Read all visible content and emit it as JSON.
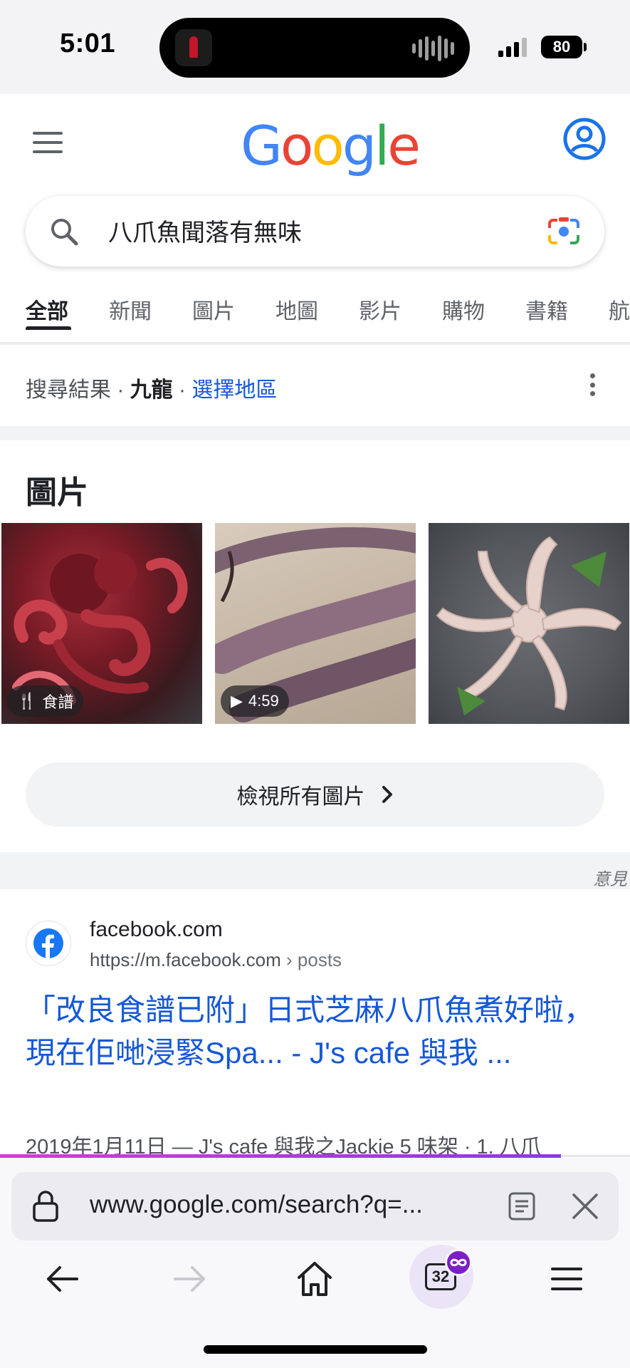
{
  "status_bar": {
    "time": "5:01",
    "battery": "80"
  },
  "header": {
    "logo": "Google"
  },
  "search": {
    "query": "八爪魚聞落有無味"
  },
  "tabs": [
    "全部",
    "新聞",
    "圖片",
    "地圖",
    "影片",
    "購物",
    "書籍",
    "航"
  ],
  "location": {
    "prefix": "搜尋結果",
    "sep1": "·",
    "place": "九龍",
    "sep2": "·",
    "choose": "選擇地區"
  },
  "images": {
    "title": "圖片",
    "thumbs": [
      {
        "badge": "食譜",
        "badge_icon": "utensils-icon"
      },
      {
        "badge": "4:59",
        "badge_icon": "play-icon"
      },
      {
        "badge": null
      }
    ],
    "view_all": "檢視所有圖片"
  },
  "feedback": "意見",
  "result": {
    "site": "facebook.com",
    "url": "https://m.facebook.com",
    "path": "› posts",
    "title": "「改良食譜已附」日式芝麻八爪魚煮好啦，現在佢哋浸緊Spa... - J's cafe 與我 ...",
    "snippet": "2019年1月11日 — J's cafe 與我之Jackie 5 味架 · 1. 八爪"
  },
  "browser": {
    "url": "www.google.com/search?q=...",
    "tab_count": "32",
    "progress": 0.89
  }
}
